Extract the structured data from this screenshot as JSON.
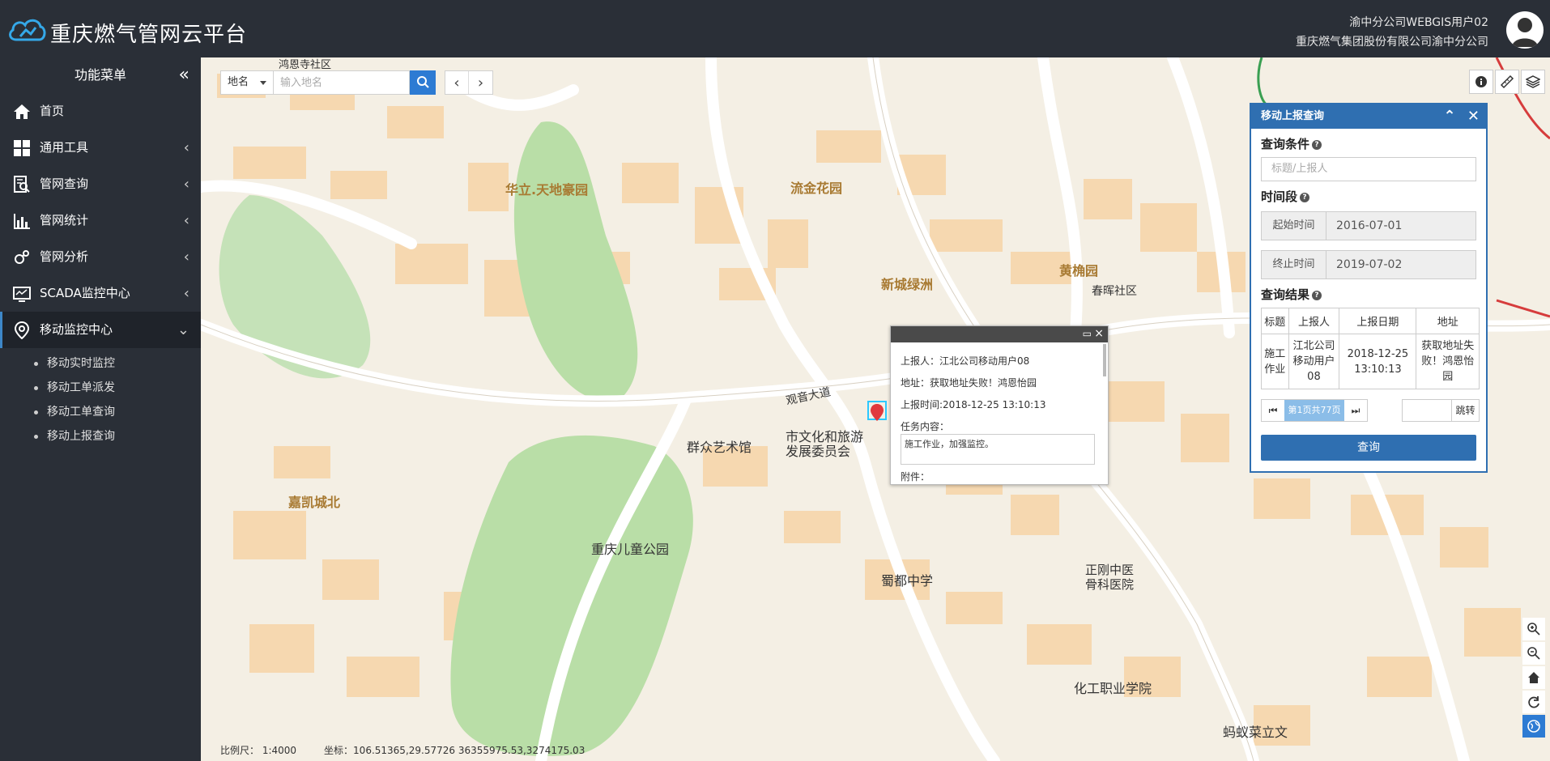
{
  "header": {
    "app_title": "重庆燃气管网云平台",
    "user_name": "渝中分公司WEBGIS用户02",
    "user_org": "重庆燃气集团股份有限公司渝中分公司"
  },
  "sidebar": {
    "menu_title": "功能菜单",
    "collapse_icon": "«",
    "items": [
      {
        "label": "首页",
        "icon": "home-icon"
      },
      {
        "label": "通用工具",
        "icon": "grid-icon"
      },
      {
        "label": "管网查询",
        "icon": "search-doc-icon"
      },
      {
        "label": "管网统计",
        "icon": "bar-chart-icon"
      },
      {
        "label": "管网分析",
        "icon": "analysis-icon"
      },
      {
        "label": "SCADA监控中心",
        "icon": "monitor-icon"
      },
      {
        "label": "移动监控中心",
        "icon": "location-icon"
      }
    ],
    "sub_items": [
      "移动实时监控",
      "移动工单派发",
      "移动工单查询",
      "移动上报查询"
    ]
  },
  "search": {
    "type_label": "地名",
    "placeholder": "输入地名"
  },
  "panel": {
    "title": "移动上报查询",
    "condition_label": "查询条件",
    "condition_placeholder": "标题/上报人",
    "period_label": "时间段",
    "start_label": "起始时间",
    "start_value": "2016-07-01",
    "end_label": "终止时间",
    "end_value": "2019-07-02",
    "result_label": "查询结果",
    "columns": [
      "标题",
      "上报人",
      "上报日期",
      "地址"
    ],
    "rows": [
      [
        "施工作业",
        "江北公司移动用户08",
        "2018-12-25 13:10:13",
        "获取地址失败！鸿恩怡园"
      ]
    ],
    "page_info": "第1页共77页",
    "jump_label": "跳转",
    "query_button": "查询"
  },
  "popup": {
    "reporter": "上报人：江北公司移动用户08",
    "address": "地址：获取地址失败！鸿恩怡园",
    "time": "上报时间:2018-12-25 13:10:13",
    "task_label": "任务内容：",
    "task_value": "施工作业，加强监控。",
    "attach_label": "附件："
  },
  "statusbar": {
    "scale": "比例尺：  1:4000",
    "coords": "坐标：106.51365,29.57726    36355975.53,3274175.03"
  },
  "map_labels": {
    "huali": "华立.天地豪园",
    "liujin": "流金花园",
    "xincheng": "新城绿洲",
    "huangjue": "黄桷园",
    "chunhui": "春晖社区",
    "qunzhong": "群众艺术馆",
    "wenhua": "市文化和旅游发展委员会",
    "jiakai": "嘉凯城北",
    "ertong": "重庆儿童公园",
    "shudu": "蜀都中学",
    "zhenggang": "正刚中医骨科医院",
    "huagong": "化工职业学院",
    "hongen": "鸿恩寺社区",
    "mayi": "蚂蚁菜立文",
    "guanyin": "观音大道"
  }
}
